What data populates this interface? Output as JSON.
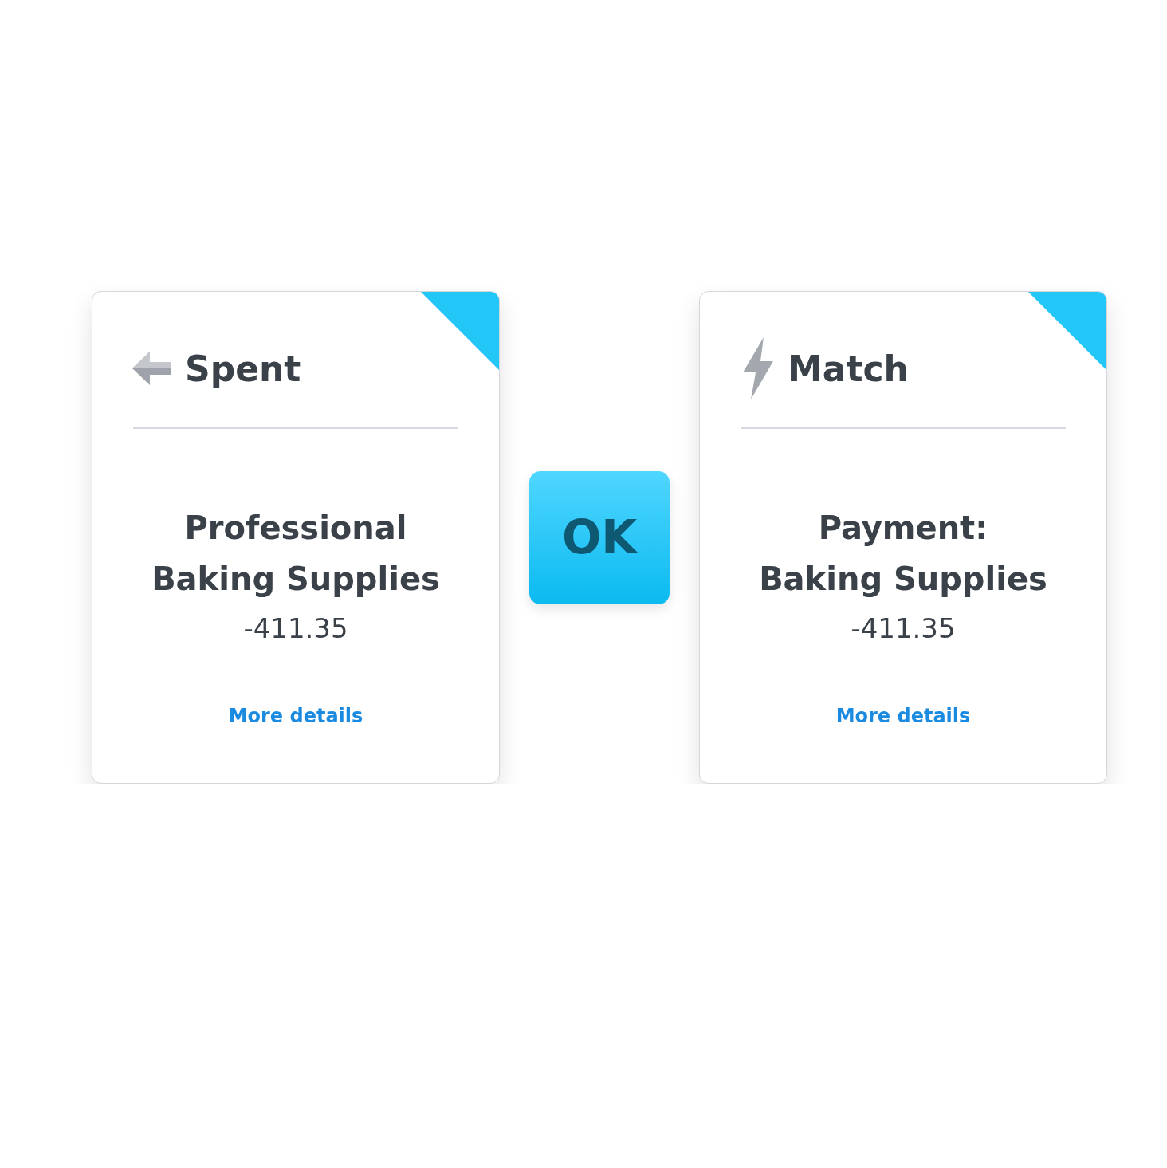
{
  "cards": [
    {
      "kind": "spent",
      "heading": "Spent",
      "title": "Professional\nBaking Supplies",
      "amount": "-411.35",
      "link": "More details"
    },
    {
      "kind": "match",
      "heading": "Match",
      "title": "Payment:\nBaking Supplies",
      "amount": "-411.35",
      "link": "More details"
    }
  ],
  "ok_button": "OK"
}
